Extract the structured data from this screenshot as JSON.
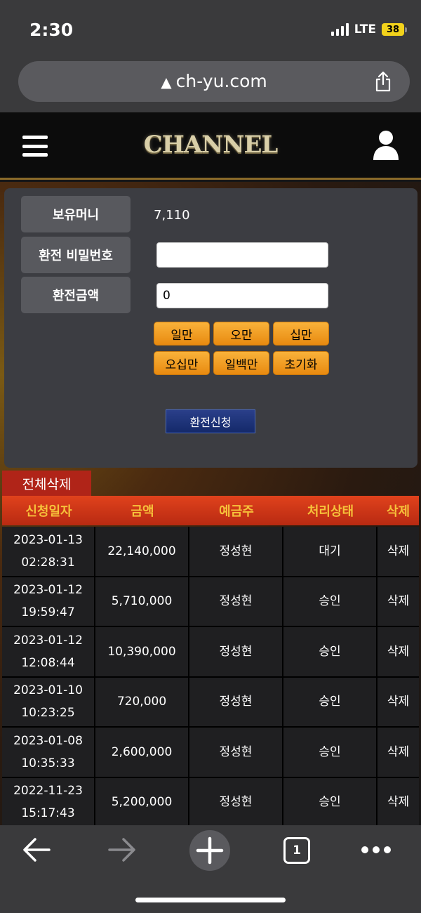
{
  "status_bar": {
    "time": "2:30",
    "network": "LTE",
    "battery": "38"
  },
  "browser": {
    "url": "ch-yu.com",
    "warning_glyph": "▲",
    "tab_count": "1"
  },
  "header": {
    "logo": "CHANNEL"
  },
  "exchange": {
    "balance_label": "보유머니",
    "balance_value": "7,110",
    "password_label": "환전 비밀번호",
    "password_value": "",
    "amount_label": "환전금액",
    "amount_value": "0",
    "amount_buttons": [
      "일만",
      "오만",
      "십만",
      "오십만",
      "일백만",
      "초기화"
    ],
    "submit_label": "환전신청"
  },
  "delete_all_label": "전체삭제",
  "table": {
    "headers": [
      "신청일자",
      "금액",
      "예금주",
      "처리상태",
      "삭제"
    ],
    "rows": [
      {
        "date": "2023-01-13",
        "time": "02:28:31",
        "amount": "22,140,000",
        "holder": "정성현",
        "status": "대기",
        "action": "삭제"
      },
      {
        "date": "2023-01-12",
        "time": "19:59:47",
        "amount": "5,710,000",
        "holder": "정성현",
        "status": "승인",
        "action": "삭제"
      },
      {
        "date": "2023-01-12",
        "time": "12:08:44",
        "amount": "10,390,000",
        "holder": "정성현",
        "status": "승인",
        "action": "삭제"
      },
      {
        "date": "2023-01-10",
        "time": "10:23:25",
        "amount": "720,000",
        "holder": "정성현",
        "status": "승인",
        "action": "삭제"
      },
      {
        "date": "2023-01-08",
        "time": "10:35:33",
        "amount": "2,600,000",
        "holder": "정성현",
        "status": "승인",
        "action": "삭제"
      },
      {
        "date": "2022-11-23",
        "time": "15:17:43",
        "amount": "5,200,000",
        "holder": "정성현",
        "status": "승인",
        "action": "삭제"
      }
    ]
  },
  "colors": {
    "accent_orange": "#f6c13a",
    "header_red": "#d43a18",
    "panel_gray": "#3c3d42",
    "button_orange": "#f9b23a",
    "submit_blue": "#1e3478"
  }
}
